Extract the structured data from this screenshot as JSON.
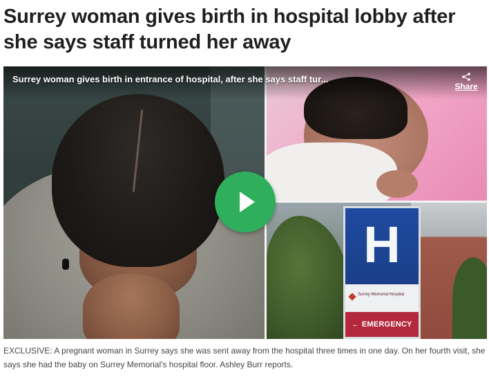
{
  "article": {
    "headline": "Surrey woman gives birth in hospital lobby after she says staff turned her away",
    "caption": "EXCLUSIVE: A pregnant woman in Surrey says she was sent away from the hospital three times in one day. On her fourth visit, she says she had the baby on Surrey Memorial's hospital floor. Ashley Burr reports."
  },
  "video": {
    "title": "Surrey woman gives birth in entrance of hospital, after she says staff tur...",
    "share_label": "Share",
    "play_icon": "play-icon",
    "play_color": "#2fae5c",
    "sign": {
      "letter": "H",
      "hospital_name": "Surrey Memorial Hospital",
      "emergency_label": "← EMERGENCY"
    }
  }
}
